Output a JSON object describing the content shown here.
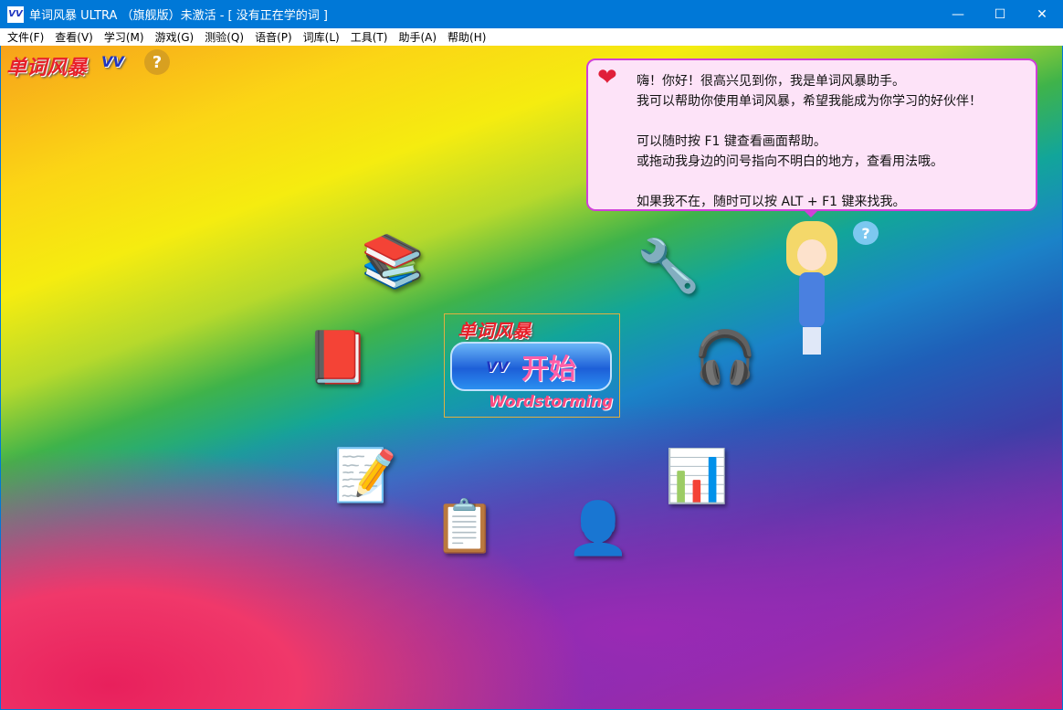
{
  "window": {
    "title": "单词风暴 ULTRA （旗舰版）未激活 - [ 没有正在学的词 ]",
    "app_icon": "VV",
    "minimize": "—",
    "maximize": "☐",
    "close": "✕"
  },
  "menu": [
    "文件(F)",
    "查看(V)",
    "学习(M)",
    "游戏(G)",
    "测验(Q)",
    "语音(P)",
    "词库(L)",
    "工具(T)",
    "助手(A)",
    "帮助(H)"
  ],
  "logo": {
    "text": "单词风暴",
    "mark": "VV",
    "help": "?"
  },
  "assistant": {
    "lines": [
      "嗨！你好！很高兴见到你，我是单词风暴助手。",
      "我可以帮助你使用单词风暴，希望我能成为你学习的好伙伴！",
      "",
      "可以随时按 F1 键查看画面帮助。",
      "或拖动我身边的问号指向不明白的地方，查看用法哦。",
      "",
      "如果我不在，随时可以按 ALT + F1 键来找我。"
    ],
    "heart": "❤",
    "question": "?"
  },
  "start": {
    "brand": "单词风暴",
    "label": "开始",
    "subtitle": "Wordstorming",
    "mark": "VV"
  },
  "icons": {
    "library": "📚",
    "tools": "🔧",
    "word_book": "📕",
    "media": "🎧",
    "test": "📝",
    "stats": "📊",
    "plan": "📋",
    "score": "👤"
  },
  "colors": {
    "titlebar": "#0078d7",
    "bubble": "#fde3f8",
    "bubble_border": "#d040d8"
  }
}
